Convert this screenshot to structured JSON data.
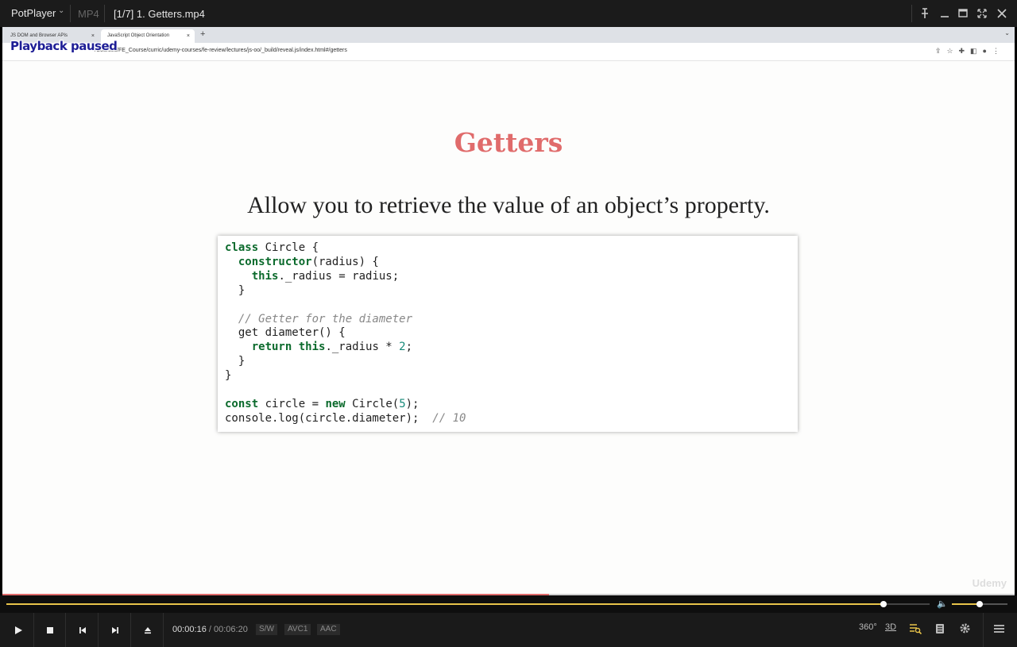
{
  "titlebar": {
    "app_name": "PotPlayer",
    "format": "MP4",
    "title": "[1/7] 1. Getters.mp4"
  },
  "browser": {
    "tabs": [
      {
        "label": "JS DOM and Browser APIs"
      },
      {
        "label": "JavaScript Object Orientation"
      }
    ],
    "url": "/Courses/FE_Course/curric/udemy-courses/fe-review/lectures/js-oo/_build/reveal.js/index.html#/getters"
  },
  "osd": {
    "status": "Playback paused"
  },
  "slide": {
    "title": "Getters",
    "subtitle": "Allow you to retrieve the value of an object’s property."
  },
  "code": {
    "language": "javascript",
    "comment1": "// Getter for the diameter",
    "comment2": "// 10",
    "lines": [
      "class Circle {",
      "  constructor(radius) {",
      "    this._radius = radius;",
      "  }",
      "",
      "  // Getter for the diameter",
      "  get diameter() {",
      "    return this._radius * 2;",
      "  }",
      "}",
      "",
      "const circle = new Circle(5);",
      "console.log(circle.diameter);  // 10"
    ]
  },
  "watermark": "Udemy",
  "playback": {
    "current_time": "00:00:16",
    "separator": "/",
    "total_time": "00:06:20",
    "video_progress_fraction": 0.54,
    "seek_fraction": 0.95,
    "volume_fraction": 0.5,
    "badges": [
      "S/W",
      "AVC1",
      "AAC"
    ]
  },
  "colors": {
    "accent": "#e8c34a",
    "slide_title": "#e06b6b",
    "keyword": "#0b6a2c",
    "number": "#178a7a"
  },
  "icons": {
    "play": "play-icon",
    "stop": "stop-icon",
    "prev": "previous-icon",
    "next": "next-icon",
    "eject": "eject-icon",
    "vr": "360-icon",
    "three_d": "3d-icon",
    "playlist": "playlist-icon",
    "chapters": "chapters-icon",
    "settings": "gear-icon",
    "menu": "menu-icon"
  }
}
